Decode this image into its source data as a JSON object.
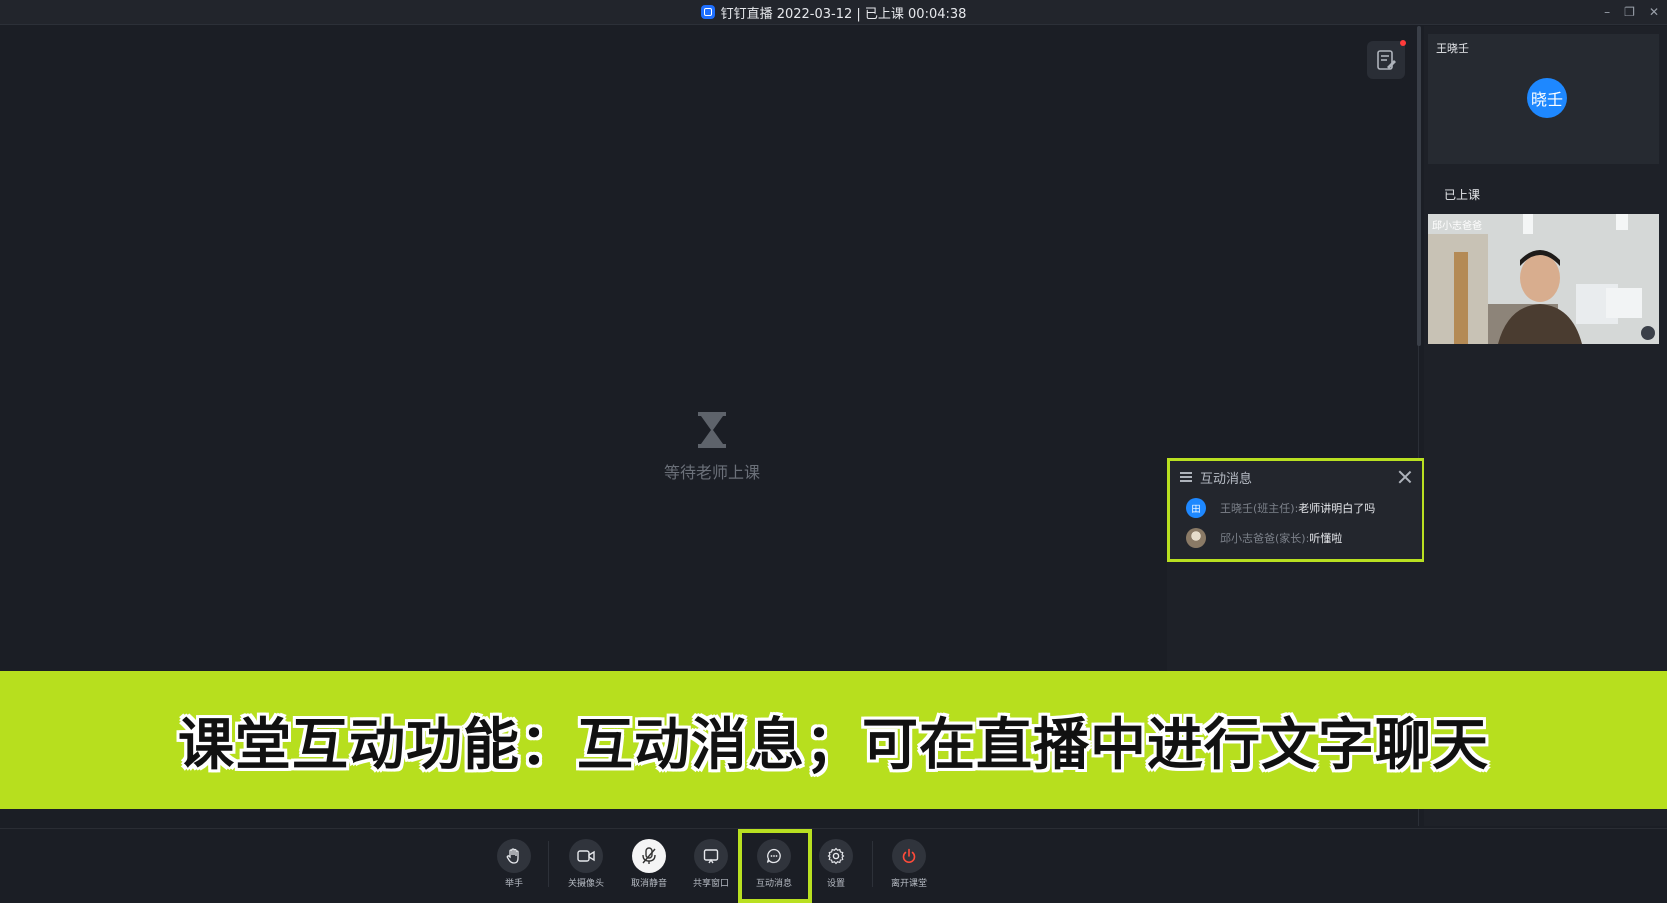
{
  "window": {
    "title": "钉钉直播 2022-03-12 | 已上课 00:04:38",
    "controls": [
      "–",
      "❐",
      "✕"
    ]
  },
  "stage": {
    "waiting_text": "等待老师上课"
  },
  "chat": {
    "title": "互动消息",
    "messages": [
      {
        "avatar_text": "田",
        "avatar_color": "#1e88ff",
        "sender": "王晓壬(班主任): ",
        "text": "老师讲明白了吗"
      },
      {
        "avatar_text": "",
        "avatar_color": "#8a7a66",
        "sender": "邱小志爸爸(家长): ",
        "text": "听懂啦"
      }
    ]
  },
  "sidebar": {
    "teacher_name": "王晓壬",
    "teacher_avatar": "晓壬",
    "section_label": "已上课",
    "student_name": "邱小志爸爸"
  },
  "banner": {
    "text": "课堂互动功能：互动消息；可在直播中进行文字聊天"
  },
  "toolbar": {
    "items": [
      {
        "label": "举手",
        "icon": "hand-icon"
      },
      {
        "label": "关摄像头",
        "icon": "camera-icon"
      },
      {
        "label": "取消静音",
        "icon": "mic-off-icon"
      },
      {
        "label": "共享窗口",
        "icon": "screen-share-icon"
      },
      {
        "label": "互动消息",
        "icon": "chat-icon"
      },
      {
        "label": "设置",
        "icon": "gear-icon"
      },
      {
        "label": "离开课堂",
        "icon": "power-icon"
      }
    ]
  },
  "colors": {
    "accent_highlight": "#b9e021",
    "leave_red": "#ff4b3a",
    "avatar_blue": "#1e88ff"
  }
}
